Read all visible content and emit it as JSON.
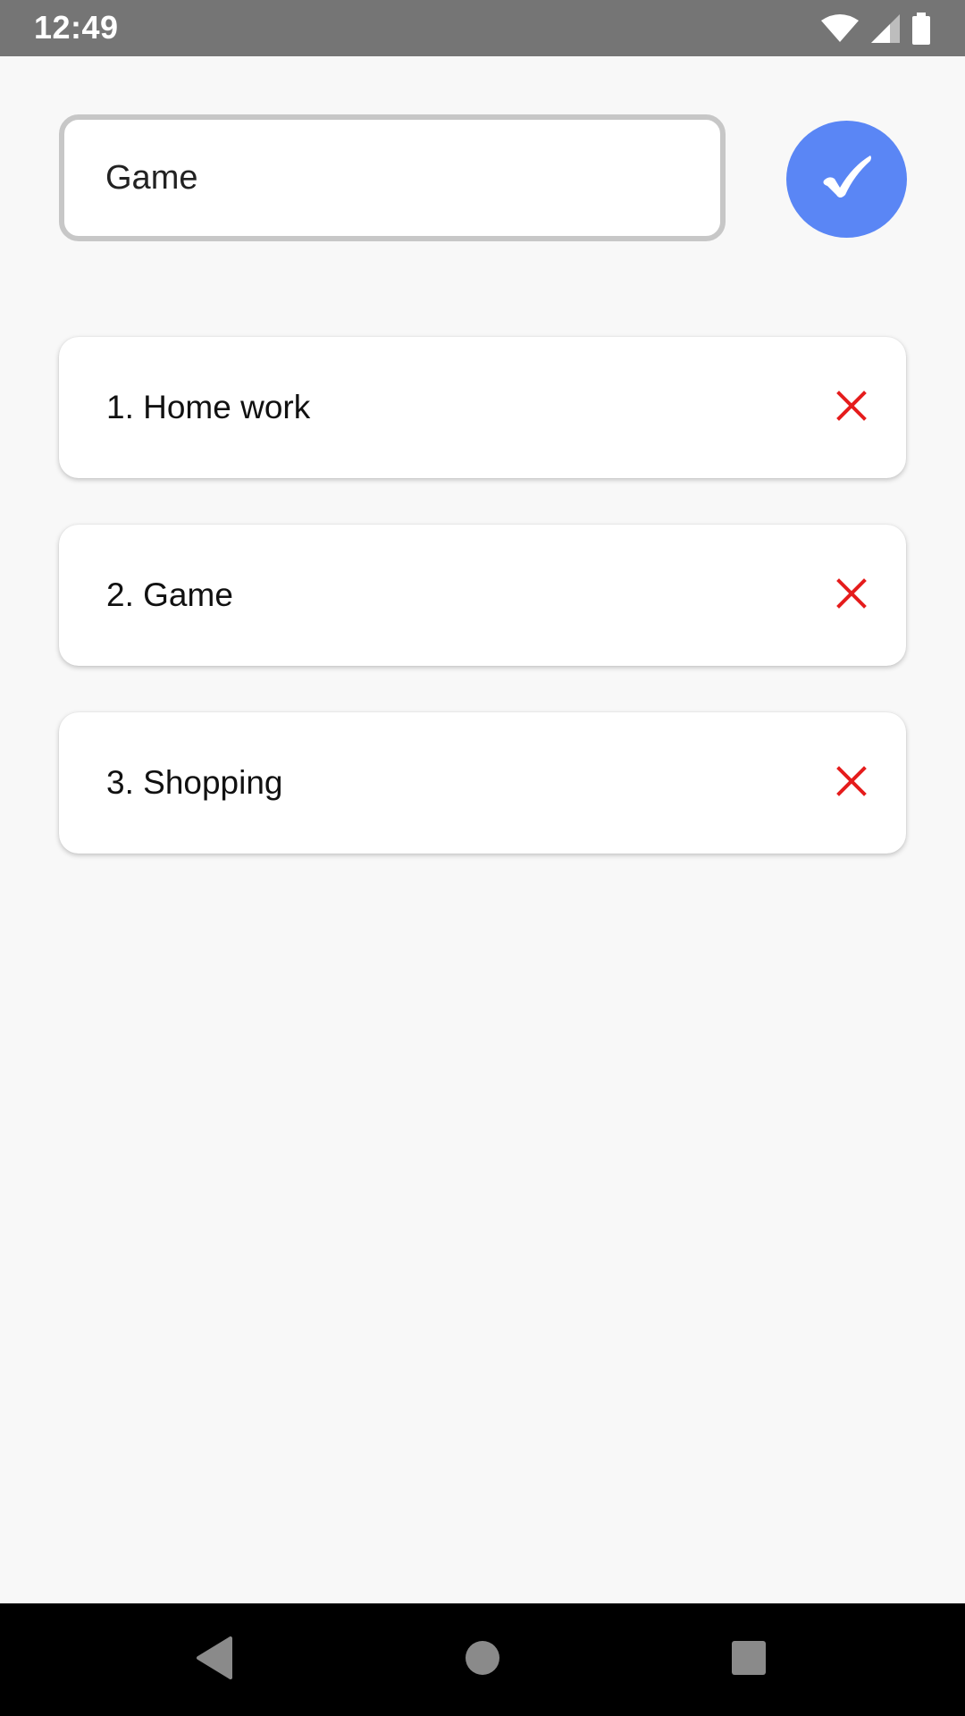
{
  "status_bar": {
    "time": "12:49",
    "icons": [
      "wifi-icon",
      "signal-icon",
      "battery-icon"
    ]
  },
  "input": {
    "value": "Game",
    "confirm_icon": "check-icon"
  },
  "tasks": [
    {
      "label": "1. Home work",
      "delete_icon": "close-icon"
    },
    {
      "label": "2. Game",
      "delete_icon": "close-icon"
    },
    {
      "label": "3. Shopping",
      "delete_icon": "close-icon"
    }
  ],
  "nav_bar": {
    "buttons": [
      "back-icon",
      "home-icon",
      "recents-icon"
    ]
  },
  "colors": {
    "accent": "#5a86f5",
    "delete": "#e51c1c",
    "status_bar": "#757575",
    "input_border": "#c7c7c7",
    "background": "#f8f8f8"
  }
}
